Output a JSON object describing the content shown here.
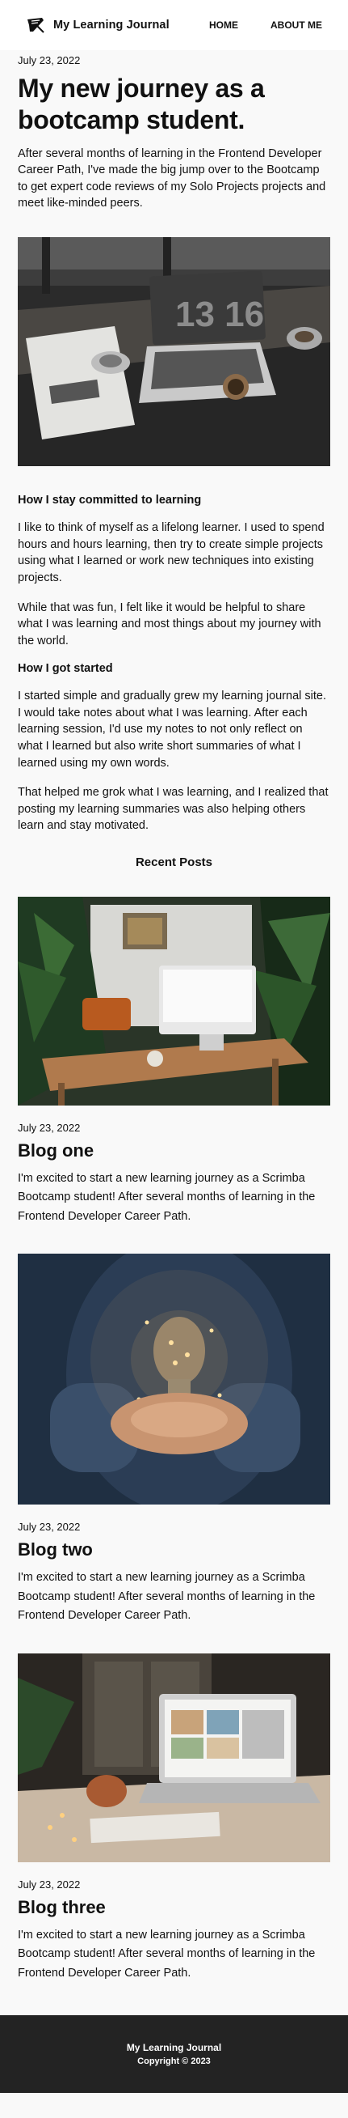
{
  "header": {
    "brand": "My Learning Journal",
    "nav": [
      {
        "label": "HOME"
      },
      {
        "label": "ABOUT ME"
      }
    ]
  },
  "article": {
    "date": "July 23, 2022",
    "title": "My new journey as a bootcamp student.",
    "intro": "After several months of learning in the Frontend Developer Career Path, I've made the big jump over to the Bootcamp to get expert code reviews of my Solo Projects projects and meet like-minded peers.",
    "hero_clock": "13 16",
    "sections": [
      {
        "heading": "How I stay committed to learning",
        "paragraphs": [
          "I like to think of myself as a lifelong learner. I used to spend hours and hours learning, then try to create simple projects using what I learned or work new techniques into existing projects.",
          "While that was fun, I felt like it would be helpful to share what I was learning and most things about my journey with the world."
        ]
      },
      {
        "heading": "How I got started",
        "paragraphs": [
          "I started simple and gradually grew my learning journal site. I would take notes about what I was learning. After each learning session, I'd use my notes to not only reflect on what I learned but also write short summaries of what I learned using my own words.",
          "That helped me grok what I was learning, and I realized that posting my learning summaries was also helping others learn and stay motivated."
        ]
      }
    ]
  },
  "recent": {
    "title": "Recent Posts",
    "posts": [
      {
        "date": "July 23, 2022",
        "title": "Blog one",
        "excerpt": "I'm excited to start a new learning journey as a Scrimba Bootcamp student! After several months of learning in the Frontend Developer Career Path."
      },
      {
        "date": "July 23, 2022",
        "title": "Blog two",
        "excerpt": "I'm excited to start a new learning journey as a Scrimba Bootcamp student! After several months of learning in the Frontend Developer Career Path."
      },
      {
        "date": "July 23, 2022",
        "title": "Blog three",
        "excerpt": "I'm excited to start a new learning journey as a Scrimba Bootcamp student! After several months of learning in the Frontend Developer Career Path."
      }
    ]
  },
  "footer": {
    "title": "My Learning Journal",
    "copyright": "Copyright © 2023"
  }
}
